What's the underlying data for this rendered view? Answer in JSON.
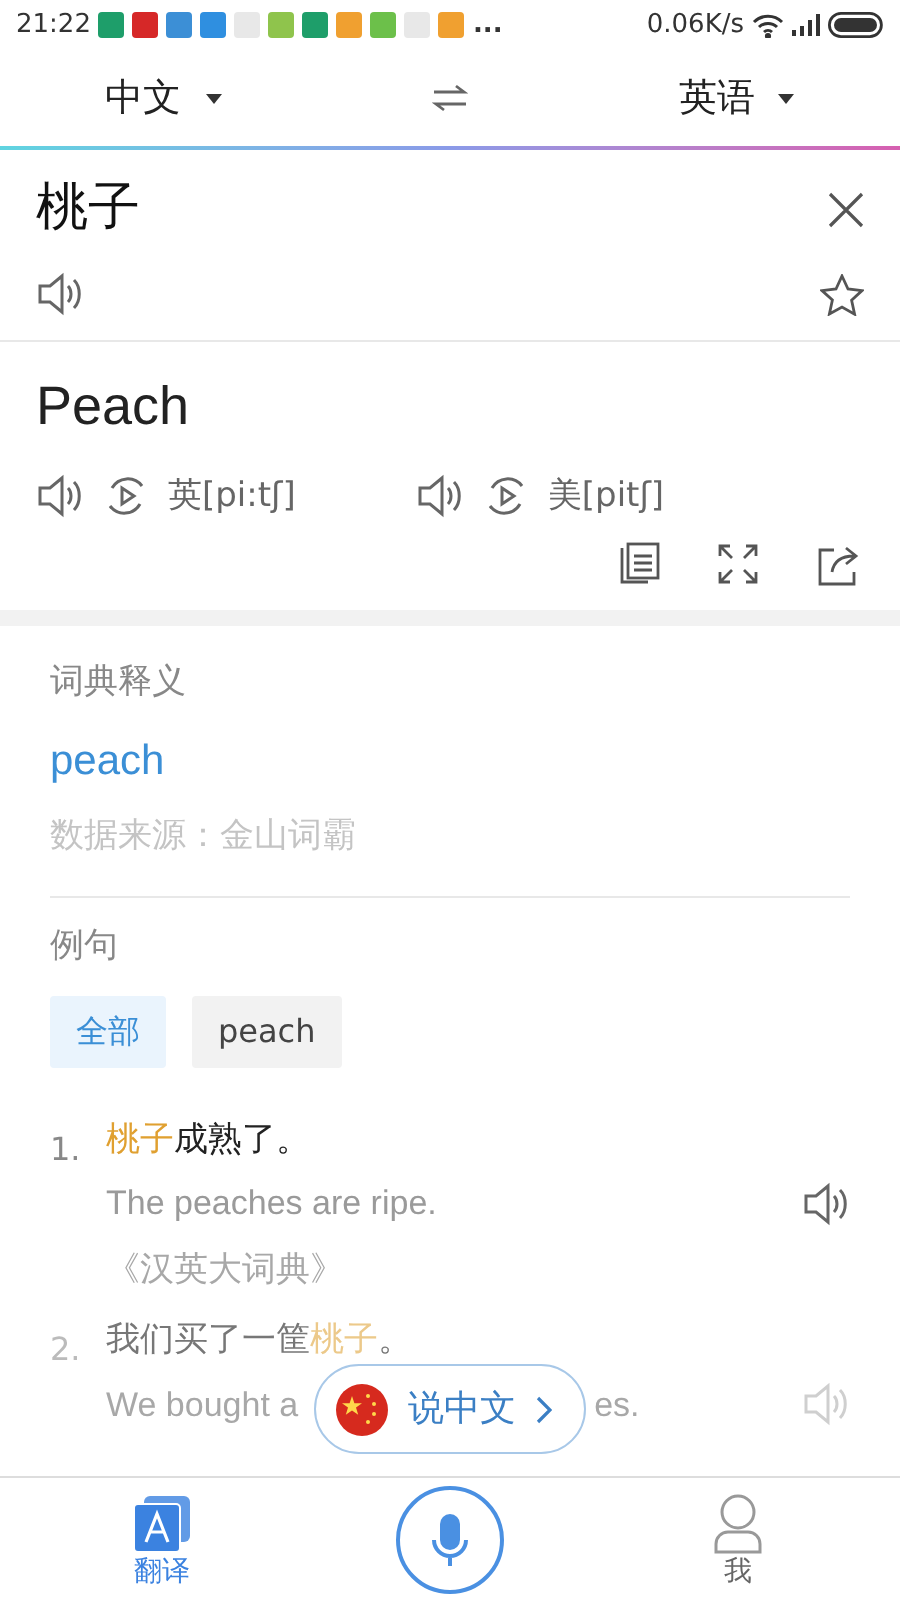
{
  "status_bar": {
    "time": "21:22",
    "more": "...",
    "speed": "0.06K/s"
  },
  "language_bar": {
    "source": "中文",
    "target": "英语"
  },
  "input": {
    "text": "桃子",
    "starred": false
  },
  "result": {
    "text": "Peach",
    "phonetics": [
      {
        "label": "英[pi:tʃ]"
      },
      {
        "label": "美[pitʃ]"
      }
    ]
  },
  "dictionary": {
    "heading": "词典释义",
    "definition": "peach",
    "source": "数据来源：金山词霸"
  },
  "examples": {
    "heading": "例句",
    "filters": [
      {
        "label": "全部",
        "selected": true
      },
      {
        "label": "peach",
        "selected": false
      }
    ],
    "items": [
      {
        "number": "1.",
        "parts": [
          {
            "text": "桃子",
            "highlight": true
          },
          {
            "text": "成熟了。",
            "highlight": false
          }
        ],
        "translation": "The peaches are ripe.",
        "source": "《汉英大词典》",
        "faded": false
      },
      {
        "number": "2.",
        "parts": [
          {
            "text": "我们买了一筐",
            "highlight": false
          },
          {
            "text": "桃子",
            "highlight": true
          },
          {
            "text": "。",
            "highlight": false
          }
        ],
        "translation_start": "We bought a",
        "translation_end": "es.",
        "faded": true
      }
    ]
  },
  "speak_button": {
    "label": "说中文"
  },
  "bottom_nav": [
    {
      "label": "翻译",
      "kind": "translate",
      "selected": true
    },
    {
      "kind": "mic"
    },
    {
      "label": "我",
      "kind": "profile",
      "selected": false
    }
  ]
}
